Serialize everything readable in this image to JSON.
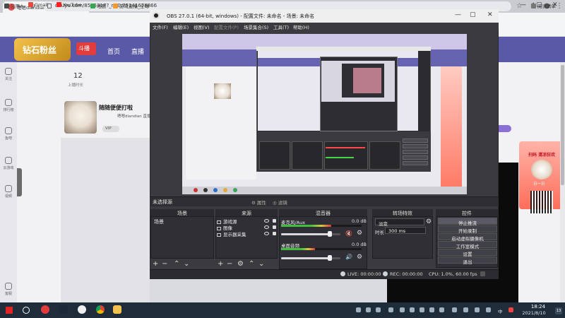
{
  "browser": {
    "tab_title": "嗯嗯diandian直播_CS:GO直播",
    "url": "douyu.com/8575317?_r=0.75141678866",
    "bookmarks": [
      {
        "label": "应用"
      },
      {
        "label": "Gmail"
      },
      {
        "label": "YouTube"
      },
      {
        "label": "地图"
      },
      {
        "label": "游戏直播_全球"
      }
    ],
    "reading_list": "阅读清单"
  },
  "page": {
    "nav": [
      "首页",
      "直播"
    ],
    "logo_text": "钻石粉丝",
    "badge": "斗播",
    "stats": [
      {
        "value": "12",
        "label": "上播时长"
      }
    ],
    "streamer": {
      "name": "随随便便打啦",
      "sub": "嗯嗯diandian 直播",
      "vip": "VIP"
    },
    "ad": {
      "title": "扫码 清凉狂欢",
      "sub": "日一日"
    },
    "sidebar": [
      {
        "label": "关注"
      },
      {
        "label": "排行榜"
      },
      {
        "label": "鱼吧"
      },
      {
        "label": "云游戏"
      },
      {
        "label": "视频"
      },
      {
        "label": "客服"
      }
    ]
  },
  "obs": {
    "title": "OBS 27.0.1 (64-bit, windows) - 配置文件: 未命名 - 场景: 未命名",
    "menu": [
      {
        "label": "文件(F)",
        "disabled": false
      },
      {
        "label": "编辑(E)",
        "disabled": false
      },
      {
        "label": "视图(V)",
        "disabled": false
      },
      {
        "label": "配置文件(P)",
        "disabled": true
      },
      {
        "label": "场景集合(S)",
        "disabled": false
      },
      {
        "label": "工具(T)",
        "disabled": false
      },
      {
        "label": "帮助(H)",
        "disabled": false
      }
    ],
    "unselected_source": "未选择源",
    "properties_btn": "属性",
    "filters_btn": "滤镜",
    "docks": {
      "scenes": "场景",
      "sources": "来源",
      "mixer": "混音器",
      "transitions": "转场特效",
      "controls": "控件"
    },
    "scenes": [
      "场景"
    ],
    "sources": [
      {
        "label": "游戏源"
      },
      {
        "label": "图像"
      },
      {
        "label": "显示器采集"
      }
    ],
    "mixer": [
      {
        "label": "麦克风/Aux",
        "db": "0.0 dB",
        "level": 0.62,
        "volume": 0.82,
        "muted": true
      },
      {
        "label": "桌面音频",
        "db": "0.0 dB",
        "level": 0.42,
        "volume": 0.82,
        "muted": false
      }
    ],
    "transitions": {
      "type": "淡变",
      "duration_label": "时长",
      "duration": "300 ms"
    },
    "controls": [
      {
        "label": "停止推流",
        "active": true
      },
      {
        "label": "开始录制",
        "active": false
      },
      {
        "label": "启动虚拟摄像机",
        "active": false
      },
      {
        "label": "工作室模式",
        "active": false
      },
      {
        "label": "设置",
        "active": false
      },
      {
        "label": "退出",
        "active": false
      }
    ],
    "status": {
      "live": "LIVE: 00:00:00",
      "rec": "REC: 00:00:00",
      "cpu": "CPU: 1.0%, 60.00 fps"
    }
  },
  "taskbar": {
    "time": "18:24",
    "date": "2021/8/10",
    "ime": "中",
    "notification_count": "13"
  }
}
